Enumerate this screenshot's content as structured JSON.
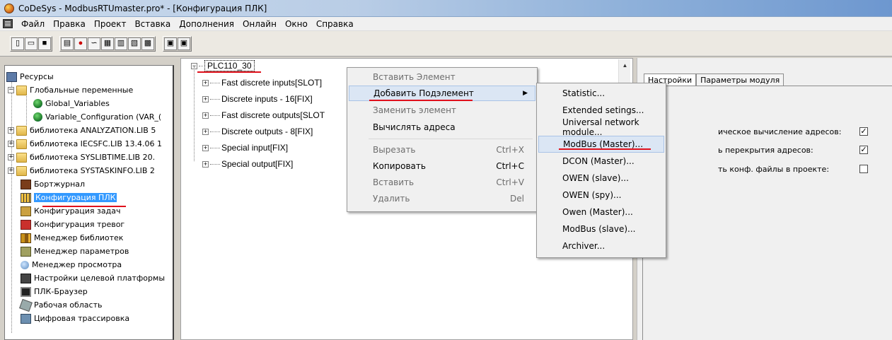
{
  "window": {
    "title": "CoDeSys - ModbusRTUmaster.pro* - [Конфигурация ПЛК]"
  },
  "menu": [
    "Файл",
    "Правка",
    "Проект",
    "Вставка",
    "Дополнения",
    "Онлайн",
    "Окно",
    "Справка"
  ],
  "toolbar": {
    "group1": [
      "new-file-icon",
      "open-icon",
      "save-icon"
    ],
    "group2": [
      "build-icon",
      "stop-icon",
      "link-icon",
      "compile-icon",
      "login-icon",
      "logout-icon",
      "run-icon"
    ],
    "group3": [
      "project-icon-a",
      "project-icon-b"
    ]
  },
  "tree": {
    "root": "Ресурсы",
    "globals": "Глобальные переменные",
    "global_vars": "Global_Variables",
    "var_config": "Variable_Configuration (VAR_(",
    "lib1": "библиотека ANALYZATION.LIB 5",
    "lib2": "библиотека IECSFC.LIB 13.4.06 1",
    "lib3": "библиотека SYSLIBTIME.LIB 20.",
    "lib4": "библиотека SYSTASKINFO.LIB 2",
    "journal": "Бортжурнал",
    "plc_config": "Конфигурация ПЛК",
    "task_config": "Конфигурация задач",
    "alarm_config": "Конфигурация тревог",
    "lib_manager": "Менеджер библиотек",
    "param_manager": "Менеджер параметров",
    "view_manager": "Менеджер просмотра",
    "target_settings": "Настройки целевой платформы",
    "plc_browser": "ПЛК-Браузер",
    "workspace": "Рабочая область",
    "trace": "Цифровая трассировка"
  },
  "config": {
    "root": "PLC110_30",
    "items": [
      "Fast discrete inputs[SLOT]",
      "Discrete inputs - 16[FIX]",
      "Fast discrete outputs[SLOT",
      "Discrete outputs - 8[FIX]",
      "Special input[FIX]",
      "Special output[FIX]"
    ]
  },
  "context_menu": {
    "insert_element": "Вставить Элемент",
    "add_subelement": "Добавить Подэлемент",
    "replace_element": "Заменить элемент",
    "calc_addresses": "Вычислять адреса",
    "cut": "Вырезать",
    "cut_shortcut": "Ctrl+X",
    "copy": "Копировать",
    "copy_shortcut": "Ctrl+C",
    "paste": "Вставить",
    "paste_shortcut": "Ctrl+V",
    "delete": "Удалить",
    "delete_shortcut": "Del"
  },
  "submenu": [
    "Statistic...",
    "Extended setings...",
    "Universal network module...",
    "ModBus (Master)...",
    "DCON (Master)...",
    "OWEN (slave)...",
    "OWEN (spy)...",
    "Owen (Master)...",
    "ModBus (slave)...",
    "Archiver..."
  ],
  "right_panel": {
    "tab_settings": "Настройки",
    "tab_params": "Параметры модуля",
    "opt1": "ическое вычисление адресов:",
    "opt1_checked": "☑",
    "opt2": "ь перекрытия адресов:",
    "opt2_checked": "☑",
    "opt3": "ть конф. файлы в проекте:",
    "opt3_checked": "",
    "check_mark": "✓"
  },
  "colors": {
    "highlight": "#3399ff",
    "underline": "#e0101c"
  }
}
